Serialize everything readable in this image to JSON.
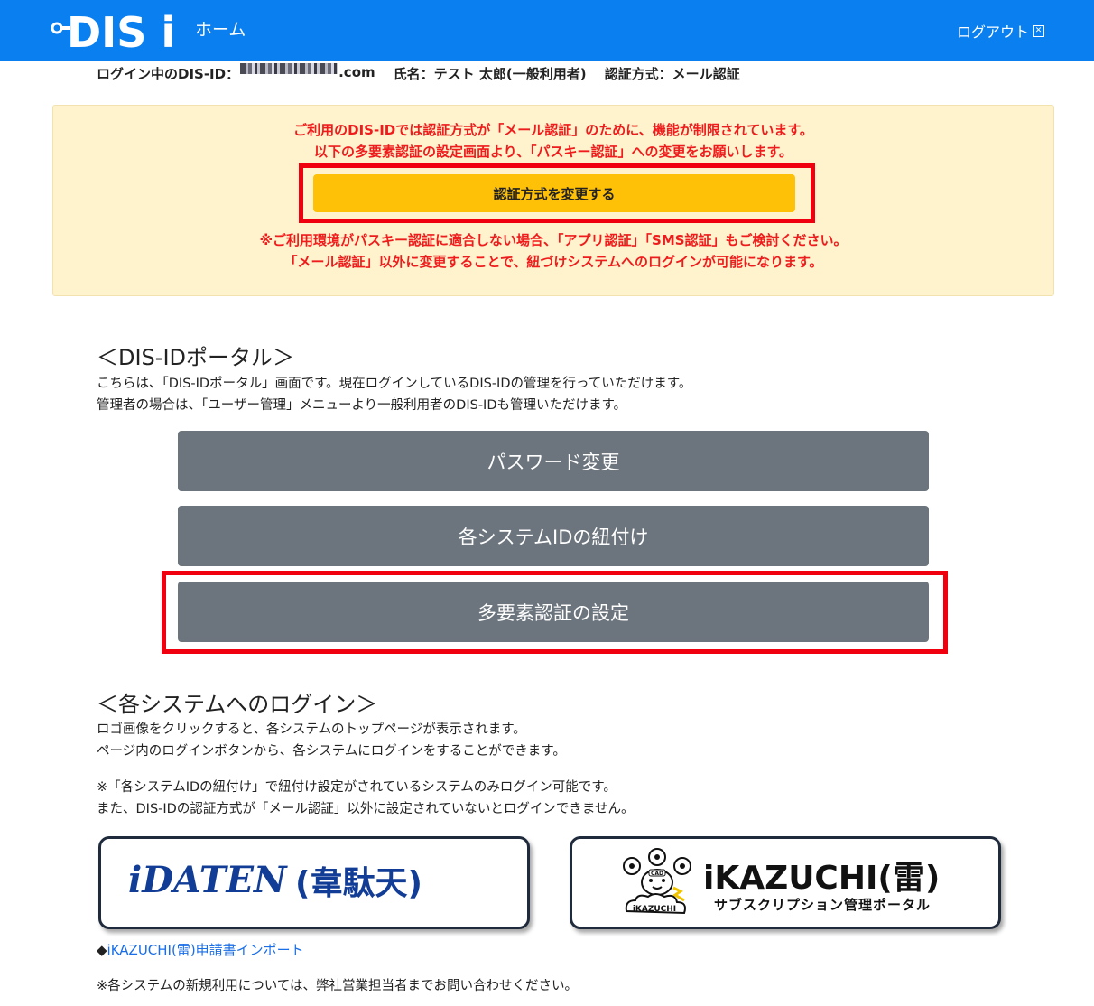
{
  "header": {
    "logo_text": "DIS iD",
    "home_label": "ホーム",
    "logout_label": "ログアウト",
    "background_color": "#0a7ff0"
  },
  "user_info": {
    "login_label": "ログイン中のDIS-ID：",
    "login_suffix": ".com",
    "name_text": "氏名：テスト 太郎(一般利用者)",
    "auth_text": "認証方式：メール認証"
  },
  "notice": {
    "line1": "ご利用のDIS-IDでは認証方式が「メール認証」のために、機能が制限されています。",
    "line2": "以下の多要素認証の設定画面より、「パスキー認証」への変更をお願いします。",
    "button_label": "認証方式を変更する",
    "line3": "※ご利用環境がパスキー認証に適合しない場合、「アプリ認証」「SMS認証」もご検討ください。",
    "line4": "「メール認証」以外に変更することで、紐づけシステムへのログインが可能になります。",
    "text_color": "#ee1c1c",
    "background_color": "#fff3cd",
    "button_color": "#ffc107"
  },
  "portal": {
    "title": "＜DIS-IDポータル＞",
    "desc1": "こちらは、「DIS-IDポータル」画面です。現在ログインしているDIS-IDの管理を行っていただけます。",
    "desc2": "管理者の場合は、「ユーザー管理」メニューより一般利用者のDIS-IDも管理いただけます。",
    "buttons": [
      {
        "label": "パスワード変更"
      },
      {
        "label": "各システムIDの紐付け"
      },
      {
        "label": "多要素認証の設定"
      }
    ],
    "button_color": "#6c757d"
  },
  "systems": {
    "title": "＜各システムへのログイン＞",
    "desc1": "ロゴ画像をクリックすると、各システムのトップページが表示されます。",
    "desc2": "ページ内のログインボタンから、各システムにログインをすることができます。",
    "note1": "※「各システムIDの紐付け」で紐付け設定がされているシステムのみログイン可能です。",
    "note2": "また、DIS-IDの認証方式が「メール認証」以外に設定されていないとログインできません。",
    "idaten": {
      "name": "iDATEN",
      "kanji": "(韋駄天)"
    },
    "ikazuchi": {
      "name": "iKAZUCHI",
      "kanji": "(雷)",
      "subtitle": "サブスクリプション管理ポータル",
      "mascot_label": "iKAZUCHI",
      "mascot_badge": "CAD"
    },
    "import_link_label": "iKAZUCHI(雷)申請書インポート",
    "import_link_bullet": "◆",
    "footer_note": "※各システムの新規利用については、弊社営業担当者までお問い合わせください。"
  },
  "highlight_color": "#f0000f"
}
